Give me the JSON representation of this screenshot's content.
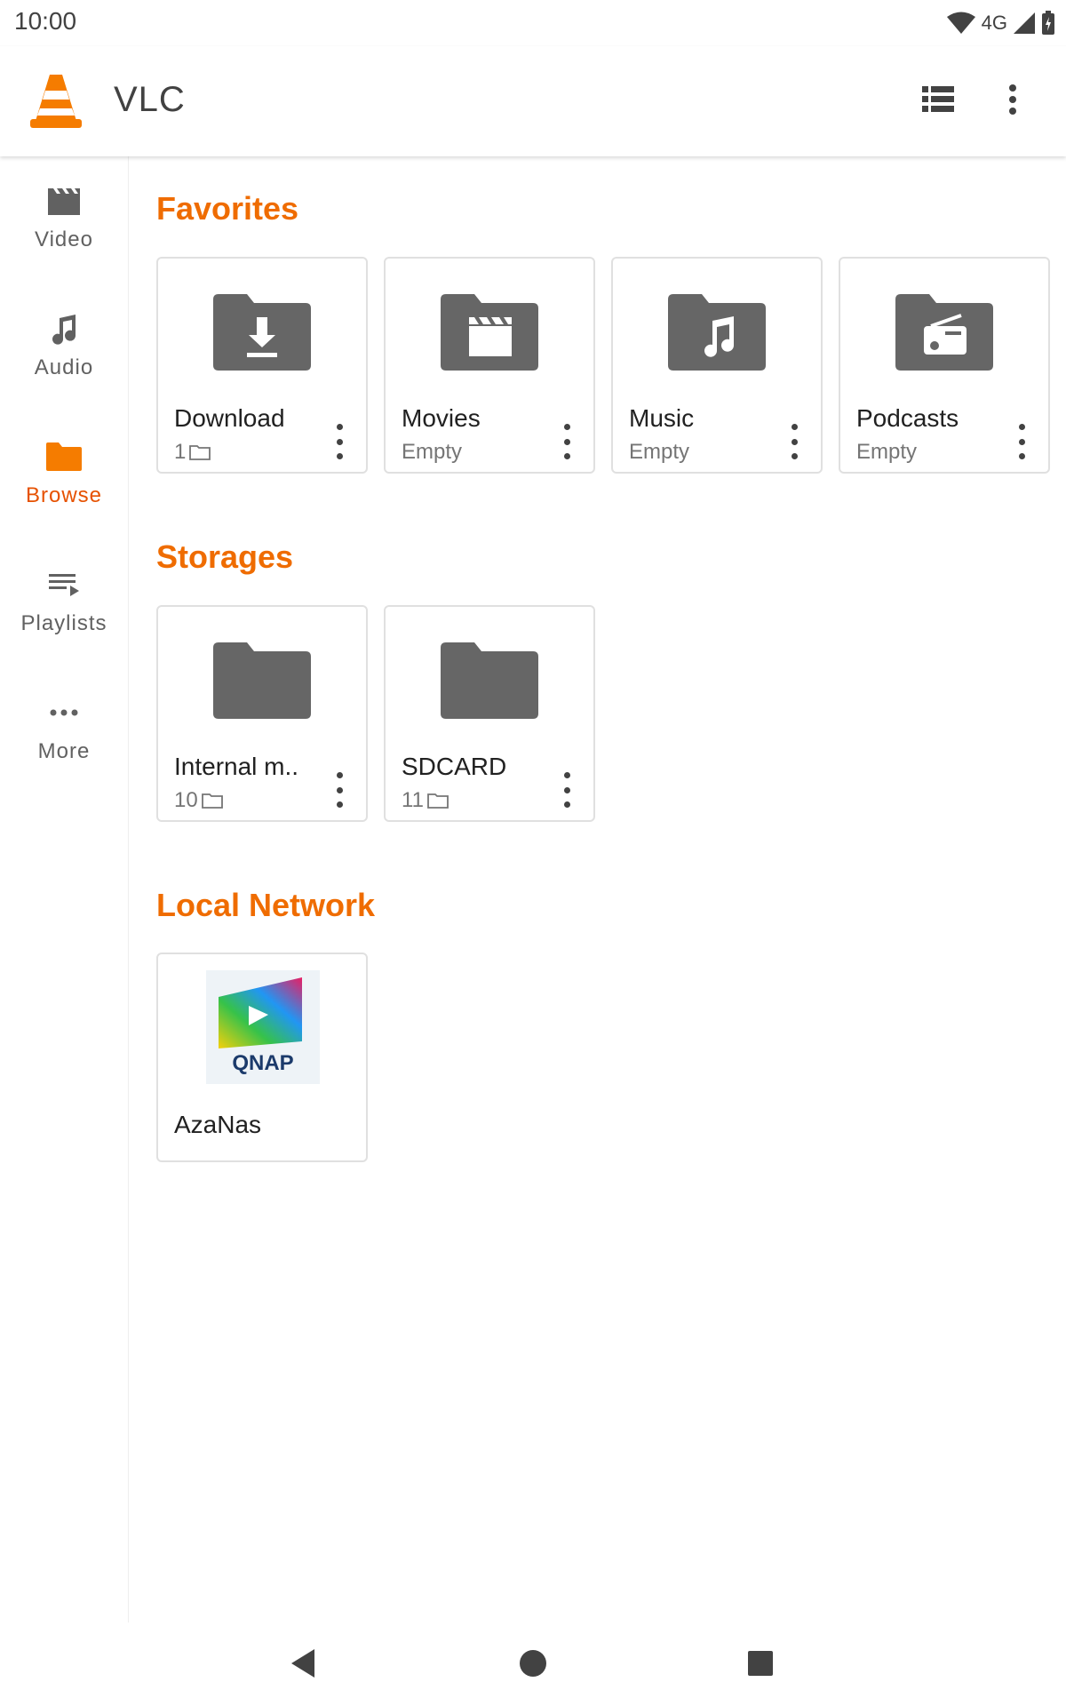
{
  "status_bar": {
    "time": "10:00",
    "network": "4G"
  },
  "app_bar": {
    "title": "VLC",
    "icons": [
      "vlc-cone-icon",
      "list-view-icon",
      "more-vertical-icon"
    ]
  },
  "sidebar": {
    "items": [
      {
        "label": "Video",
        "icon": "clapperboard-icon",
        "active": false
      },
      {
        "label": "Audio",
        "icon": "music-note-icon",
        "active": false
      },
      {
        "label": "Browse",
        "icon": "folder-icon",
        "active": true
      },
      {
        "label": "Playlists",
        "icon": "playlist-icon",
        "active": false
      },
      {
        "label": "More",
        "icon": "more-horizontal-icon",
        "active": false
      }
    ]
  },
  "favorites": {
    "title": "Favorites",
    "items": [
      {
        "name": "Download",
        "count": "1",
        "subtitle": ""
      },
      {
        "name": "Movies",
        "subtitle": "Empty"
      },
      {
        "name": "Music",
        "subtitle": "Empty"
      },
      {
        "name": "Podcasts",
        "subtitle": "Empty"
      }
    ]
  },
  "storages": {
    "title": "Storages",
    "items": [
      {
        "name": "Internal m..",
        "count": "10"
      },
      {
        "name": "SDCARD",
        "count": "11"
      }
    ]
  },
  "local_network": {
    "title": "Local Network",
    "items": [
      {
        "name": "AzaNas",
        "logo_text": "QNAP"
      }
    ]
  },
  "colors": {
    "accent": "#ef6c00",
    "icon_gray": "#616161",
    "folder_gray": "#666666"
  }
}
